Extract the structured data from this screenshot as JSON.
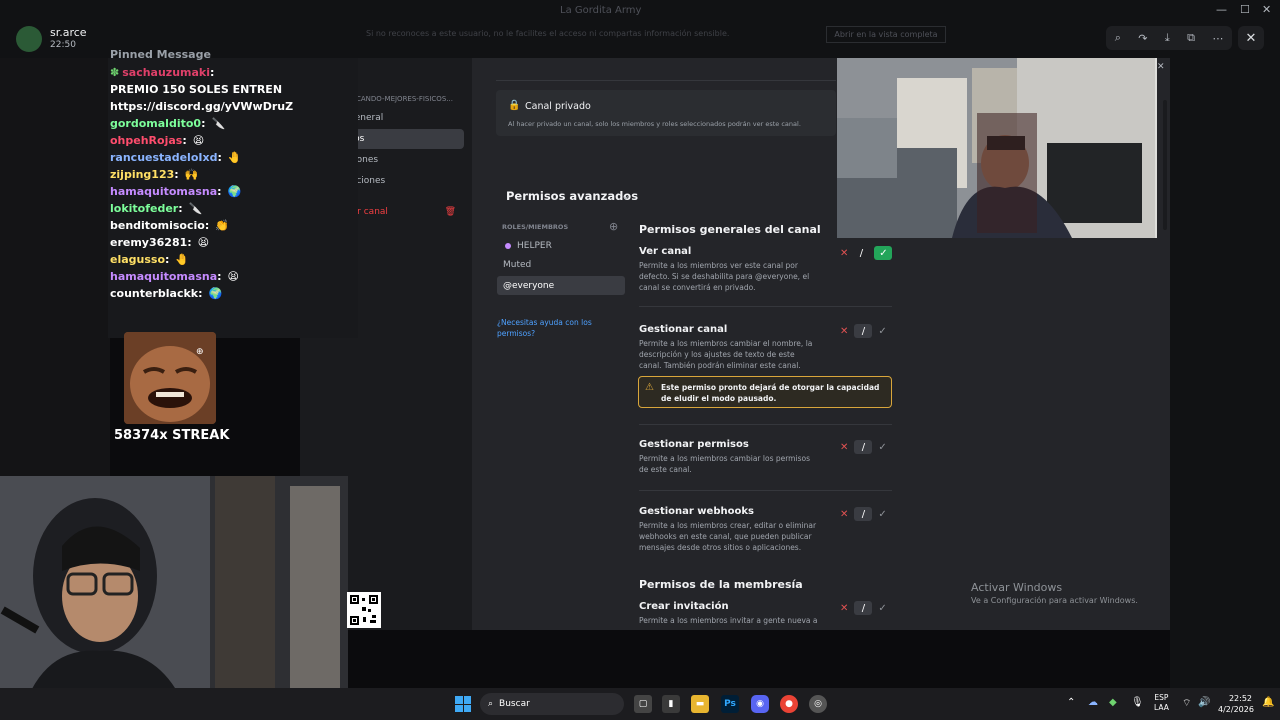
{
  "viewer": {
    "user_name": "sr.arce",
    "user_time": "22:50",
    "window_title": "La Gordita Army",
    "notice_text": "Si no reconoces a este usuario, no le facilites el acceso ni compartas información sensible.",
    "notice_button": "Abrir en la vista completa",
    "tools": [
      "⌕",
      "↷",
      "⤓",
      "⧉",
      "⋯"
    ],
    "close": "✕",
    "win_controls": [
      "—",
      "☐",
      "✕"
    ]
  },
  "chat": {
    "header_partial": "Pinned Message",
    "lines": [
      {
        "user": "sachauzumaki",
        "sep": ":",
        "msg": "",
        "color": "#e0406a",
        "badge": "✽"
      },
      {
        "user": "",
        "sep": "",
        "msg": "PREMIO 150 SOLES ENTREN",
        "color": "#ffffff"
      },
      {
        "user": "",
        "sep": "",
        "msg": "https://discord.gg/yVWwDruZ",
        "color": "#ffffff"
      },
      {
        "user": "gordomalditо0",
        "sep": ":",
        "msg": "🔪",
        "color": "#7dff9b"
      },
      {
        "user": "ohpehRojas",
        "sep": ":",
        "msg": "😫",
        "color": "#ff4d6d"
      },
      {
        "user": "rancuestadeloIxd",
        "sep": ":",
        "msg": "🤚",
        "color": "#8ab4ff"
      },
      {
        "user": "zijping123",
        "sep": ":",
        "msg": "🙌",
        "color": "#ffe066"
      },
      {
        "user": "hamaquitomasna",
        "sep": ":",
        "msg": "🌍",
        "color": "#c58bff"
      },
      {
        "user": "lokitofeder",
        "sep": ":",
        "msg": "🔪",
        "color": "#7dff9b"
      },
      {
        "user": "benditomisocio",
        "sep": ":",
        "msg": "👏",
        "color": "#ffffff"
      },
      {
        "user": "eremy36281",
        "sep": ":",
        "msg": "😫",
        "color": "#ffffff"
      },
      {
        "user": "elagusso",
        "sep": ":",
        "msg": "🤚",
        "color": "#ffe066"
      },
      {
        "user": "hamaquitomasna",
        "sep": ":",
        "msg": "😫",
        "color": "#c58bff"
      },
      {
        "user": "counterblackk",
        "sep": ":",
        "msg": "🌍",
        "color": "#ffffff"
      }
    ],
    "streak": "58374x STREAK"
  },
  "settings_sidebar": {
    "section": "CANDO-MEJORES-FISICOS...",
    "items": [
      "Vista general",
      "Permisos",
      "Invitaciones",
      "Integraciones"
    ],
    "active_index": 1,
    "delete_label": "Eliminar canal",
    "delete_color": "#f23f42"
  },
  "settings_main": {
    "private_title": "Canal privado",
    "private_desc": "Al hacer privado un canal, solo los miembros y roles seleccionados podrán ver este canal.",
    "advanced_title": "Permisos avanzados",
    "roles_header": "ROLES/MIEMBROS",
    "roles": [
      "HELPER",
      "Muted",
      "@everyone"
    ],
    "help_link": "¿Necesitas ayuda con los permisos?",
    "general_title": "Permisos generales del canal",
    "permissions": [
      {
        "name": "Ver canal",
        "desc": "Permite a los miembros ver este canal por defecto. Si se deshabilita para @everyone, el canal se convertirá en privado.",
        "state": "allow"
      },
      {
        "name": "Gestionar canal",
        "desc": "Permite a los miembros cambiar el nombre, la descripción y los ajustes de texto de este canal. También podrán eliminar este canal.",
        "state": "neutral"
      },
      {
        "name": "Gestionar permisos",
        "desc": "Permite a los miembros cambiar los permisos de este canal.",
        "state": "neutral"
      },
      {
        "name": "Gestionar webhooks",
        "desc": "Permite a los miembros crear, editar o eliminar webhooks en este canal, que pueden publicar mensajes desde otros sitios o aplicaciones.",
        "state": "neutral"
      }
    ],
    "warning": "Este permiso pronto dejará de otorgar la capacidad de eludir el modo pausado.",
    "membership_title": "Permisos de la membresía",
    "create_invite": "Crear invitación",
    "create_invite_desc": "Permite a los miembros invitar a gente nueva a"
  },
  "activate_windows": {
    "title": "Activar Windows",
    "subtitle": "Ve a Configuración para activar Windows."
  },
  "taskbar": {
    "search_placeholder": "Buscar",
    "lang_top": "ESP",
    "lang_bottom": "LAA",
    "time": "22:52",
    "date": "4/2/2026",
    "ps_label": "Ps"
  },
  "colors": {
    "discord_bg": "#242529",
    "sidebar_bg": "#1a1b1e",
    "allow_green": "#23a55a",
    "warning_gold": "#d9a63b"
  }
}
